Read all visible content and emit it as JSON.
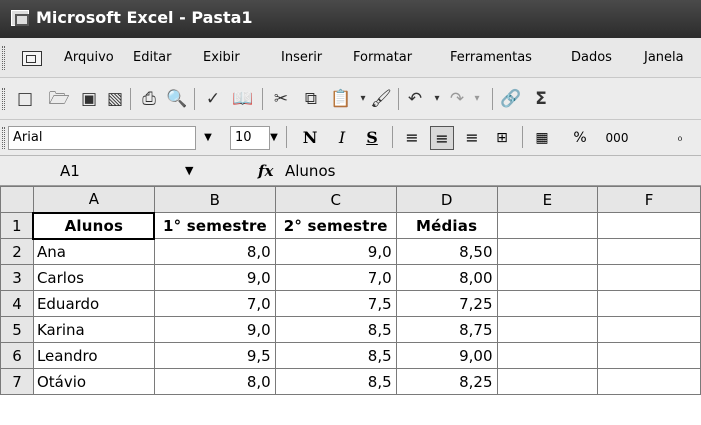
{
  "window": {
    "title": "Microsoft Excel - Pasta1"
  },
  "menu": [
    "Arquivo",
    "Editar",
    "Exibir",
    "Inserir",
    "Formatar",
    "Ferramentas",
    "Dados",
    "Janela"
  ],
  "format": {
    "font": "Arial",
    "size": "10",
    "bold": "N",
    "italic": "I",
    "underline": "S",
    "percent": "%",
    "thousands": "000"
  },
  "formula_bar": {
    "name_box": "A1",
    "fx": "fx",
    "value": "Alunos"
  },
  "columns": [
    "A",
    "B",
    "C",
    "D",
    "E",
    "F"
  ],
  "rows": [
    {
      "n": "1",
      "cells": [
        "Alunos",
        "1° semestre",
        "2° semestre",
        "Médias",
        "",
        ""
      ]
    },
    {
      "n": "2",
      "cells": [
        "Ana",
        "8,0",
        "9,0",
        "8,50",
        "",
        ""
      ]
    },
    {
      "n": "3",
      "cells": [
        "Carlos",
        "9,0",
        "7,0",
        "8,00",
        "",
        ""
      ]
    },
    {
      "n": "4",
      "cells": [
        "Eduardo",
        "7,0",
        "7,5",
        "7,25",
        "",
        ""
      ]
    },
    {
      "n": "5",
      "cells": [
        "Karina",
        "9,0",
        "8,5",
        "8,75",
        "",
        ""
      ]
    },
    {
      "n": "6",
      "cells": [
        "Leandro",
        "9,5",
        "8,5",
        "9,00",
        "",
        ""
      ]
    },
    {
      "n": "7",
      "cells": [
        "Otávio",
        "8,0",
        "8,5",
        "8,25",
        "",
        ""
      ]
    }
  ]
}
